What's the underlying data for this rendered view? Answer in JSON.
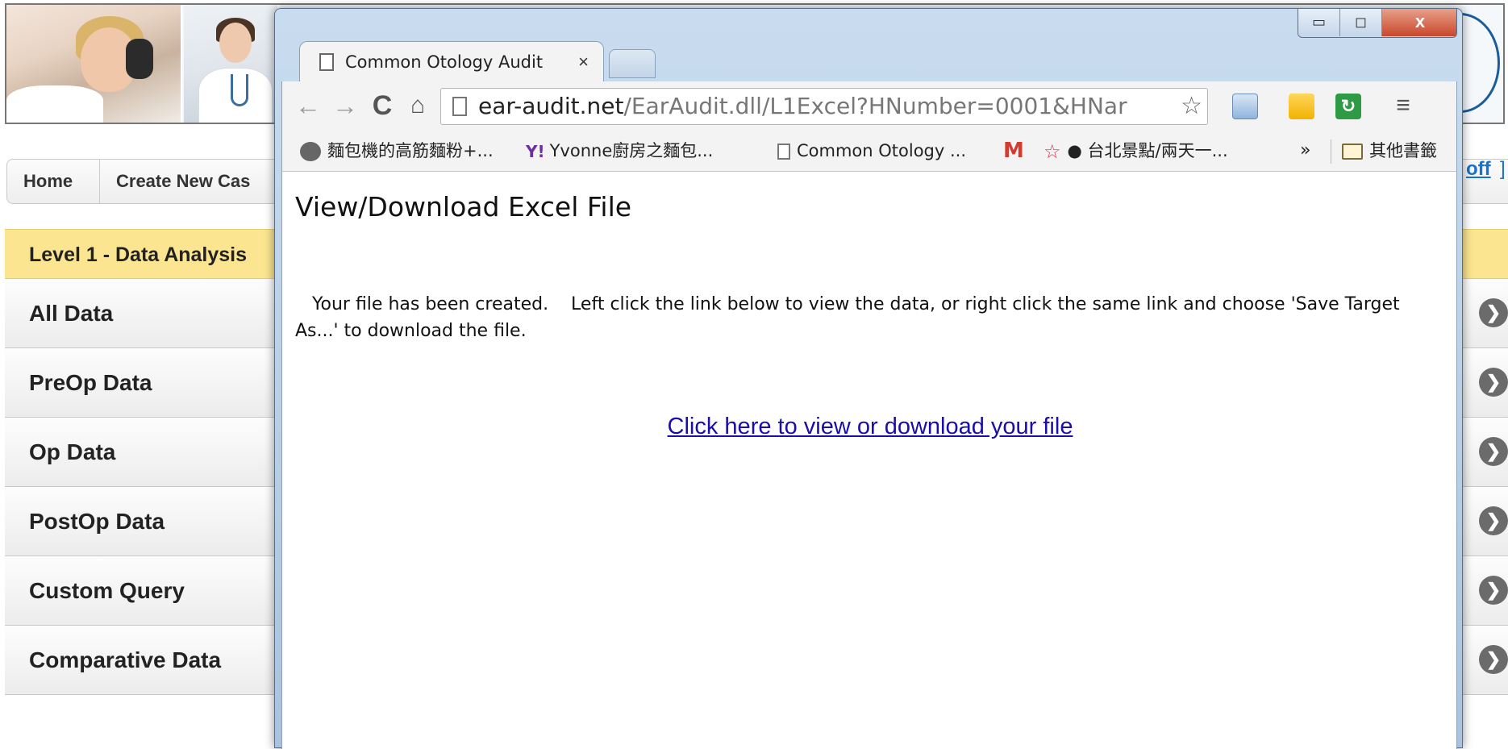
{
  "background": {
    "nav": {
      "home_label": "Home",
      "create_label": "Create New Cas",
      "logoff_label": "off",
      "logoff_bracket": "]"
    },
    "level_header": "Level 1 - Data Analysis",
    "menu_items": [
      {
        "label": "All Data",
        "arrow": "❯"
      },
      {
        "label": "PreOp Data",
        "arrow": "❯"
      },
      {
        "label": "Op Data",
        "arrow": "❯"
      },
      {
        "label": "PostOp Data",
        "arrow": "❯"
      },
      {
        "label": "Custom Query",
        "arrow": "❯"
      },
      {
        "label": "Comparative Data",
        "arrow": "❯"
      }
    ]
  },
  "browser": {
    "window_controls": {
      "minimize": "▭",
      "maximize": "◻",
      "close": "x"
    },
    "tab": {
      "title": "Common Otology Audit",
      "close": "×"
    },
    "toolbar": {
      "back": "←",
      "forward": "→",
      "reload": "C",
      "home": "⌂",
      "url_domain": "ear-audit.net",
      "url_path": "/EarAudit.dll/L1Excel?HNumber=0001&HNar",
      "star": "☆",
      "menu": "≡",
      "ext_sync": "↻"
    },
    "bookmarks": [
      {
        "label": "麵包機的高筋麵粉+..."
      },
      {
        "prefix": "Y!",
        "label": "Yvonne廚房之麵包..."
      },
      {
        "label": "Common Otology ..."
      },
      {
        "label": "M"
      },
      {
        "prefix": "☆",
        "label": "● 台北景點/兩天一..."
      },
      {
        "label": "»"
      },
      {
        "label": "其他書籤"
      }
    ]
  },
  "page": {
    "heading": "View/Download Excel File",
    "message": "   Your file has been created.    Left click the link below to view the data, or right click the same link and choose 'Save Target As...' to download the file.",
    "link_text": "Click here to view or download your file"
  }
}
